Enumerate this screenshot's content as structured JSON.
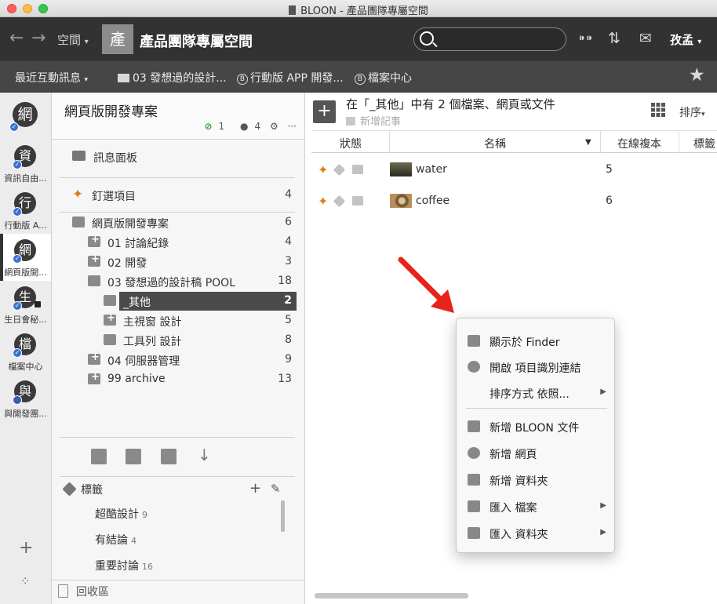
{
  "window": {
    "title": "BLOON - 產品團隊專屬空間"
  },
  "toolbar": {
    "back_glyph": "←",
    "forward_glyph": "→",
    "space_button": "空間",
    "space_avatar": "產",
    "space_title": "產品團隊專屬空間",
    "user_name": "孜孟"
  },
  "favbar": {
    "items": [
      "最近互動訊息",
      "03 發想過的設計...",
      "行動版 APP 開發...",
      "檔案中心"
    ]
  },
  "rail": {
    "top_avatar": "網",
    "items": [
      {
        "avatar": "資",
        "label": "資訊自由..."
      },
      {
        "avatar": "行",
        "label": "行動版 A..."
      },
      {
        "avatar": "網",
        "label": "網頁版開..."
      },
      {
        "avatar": "生",
        "label": "生日會秘..."
      },
      {
        "avatar": "檔",
        "label": "檔案中心"
      },
      {
        "avatar": "與",
        "label": "與開發團..."
      }
    ]
  },
  "project": {
    "title": "網頁版開發專案",
    "links": "1",
    "members": "4",
    "more": "···"
  },
  "tree": {
    "message_board": "訊息面板",
    "pinned": {
      "label": "釘選項目",
      "count": "4"
    },
    "root": {
      "label": "網頁版開發專案",
      "count": "6"
    },
    "folders": [
      {
        "label": "01 討論紀錄",
        "count": "4"
      },
      {
        "label": "02 開發",
        "count": "3"
      },
      {
        "label": "03 發想過的設計稿 POOL",
        "count": "18"
      },
      {
        "label": "_其他",
        "count": "2"
      },
      {
        "label": "主視窗 設計",
        "count": "5"
      },
      {
        "label": "工具列 設計",
        "count": "8"
      },
      {
        "label": "04 伺服器管理",
        "count": "9"
      },
      {
        "label": "99 archive",
        "count": "13"
      }
    ]
  },
  "tags": {
    "heading": "標籤",
    "items": [
      {
        "name": "超酷設計",
        "count": "9"
      },
      {
        "name": "有結論",
        "count": "4"
      },
      {
        "name": "重要討論",
        "count": "16"
      }
    ]
  },
  "trash": "回收區",
  "main": {
    "title": "在「_其他」中有 2 個檔案、網頁或文件",
    "new_note": "新增記事",
    "sort": "排序",
    "columns": [
      "狀態",
      "名稱",
      "在線複本",
      "標籤"
    ],
    "rows": [
      {
        "name": "water",
        "copies": "5"
      },
      {
        "name": "coffee",
        "copies": "6"
      }
    ]
  },
  "context_menu": {
    "items": [
      {
        "label": "顯示於 Finder",
        "icon": "finder-icon",
        "submenu": false
      },
      {
        "label": "開啟 項目識別連結",
        "icon": "link-icon",
        "submenu": false
      },
      {
        "label": "排序方式 依照...",
        "icon": "",
        "submenu": true
      },
      {
        "label": "新增 BLOON 文件",
        "icon": "document-icon",
        "submenu": false
      },
      {
        "label": "新增 網頁",
        "icon": "globe-icon",
        "submenu": false
      },
      {
        "label": "新增 資料夾",
        "icon": "folder-plus-icon",
        "submenu": false
      },
      {
        "label": "匯入 檔案",
        "icon": "import-file-icon",
        "submenu": true
      },
      {
        "label": "匯入 資料夾",
        "icon": "import-folder-icon",
        "submenu": true
      }
    ]
  },
  "colors": {
    "toolbar_bg": "#323232",
    "favbar_bg": "#464646",
    "selected_row": "#4a4a4a",
    "pin_orange": "#e07d22",
    "check_blue": "#3b6fd6",
    "arrow_red": "#e8231b"
  }
}
